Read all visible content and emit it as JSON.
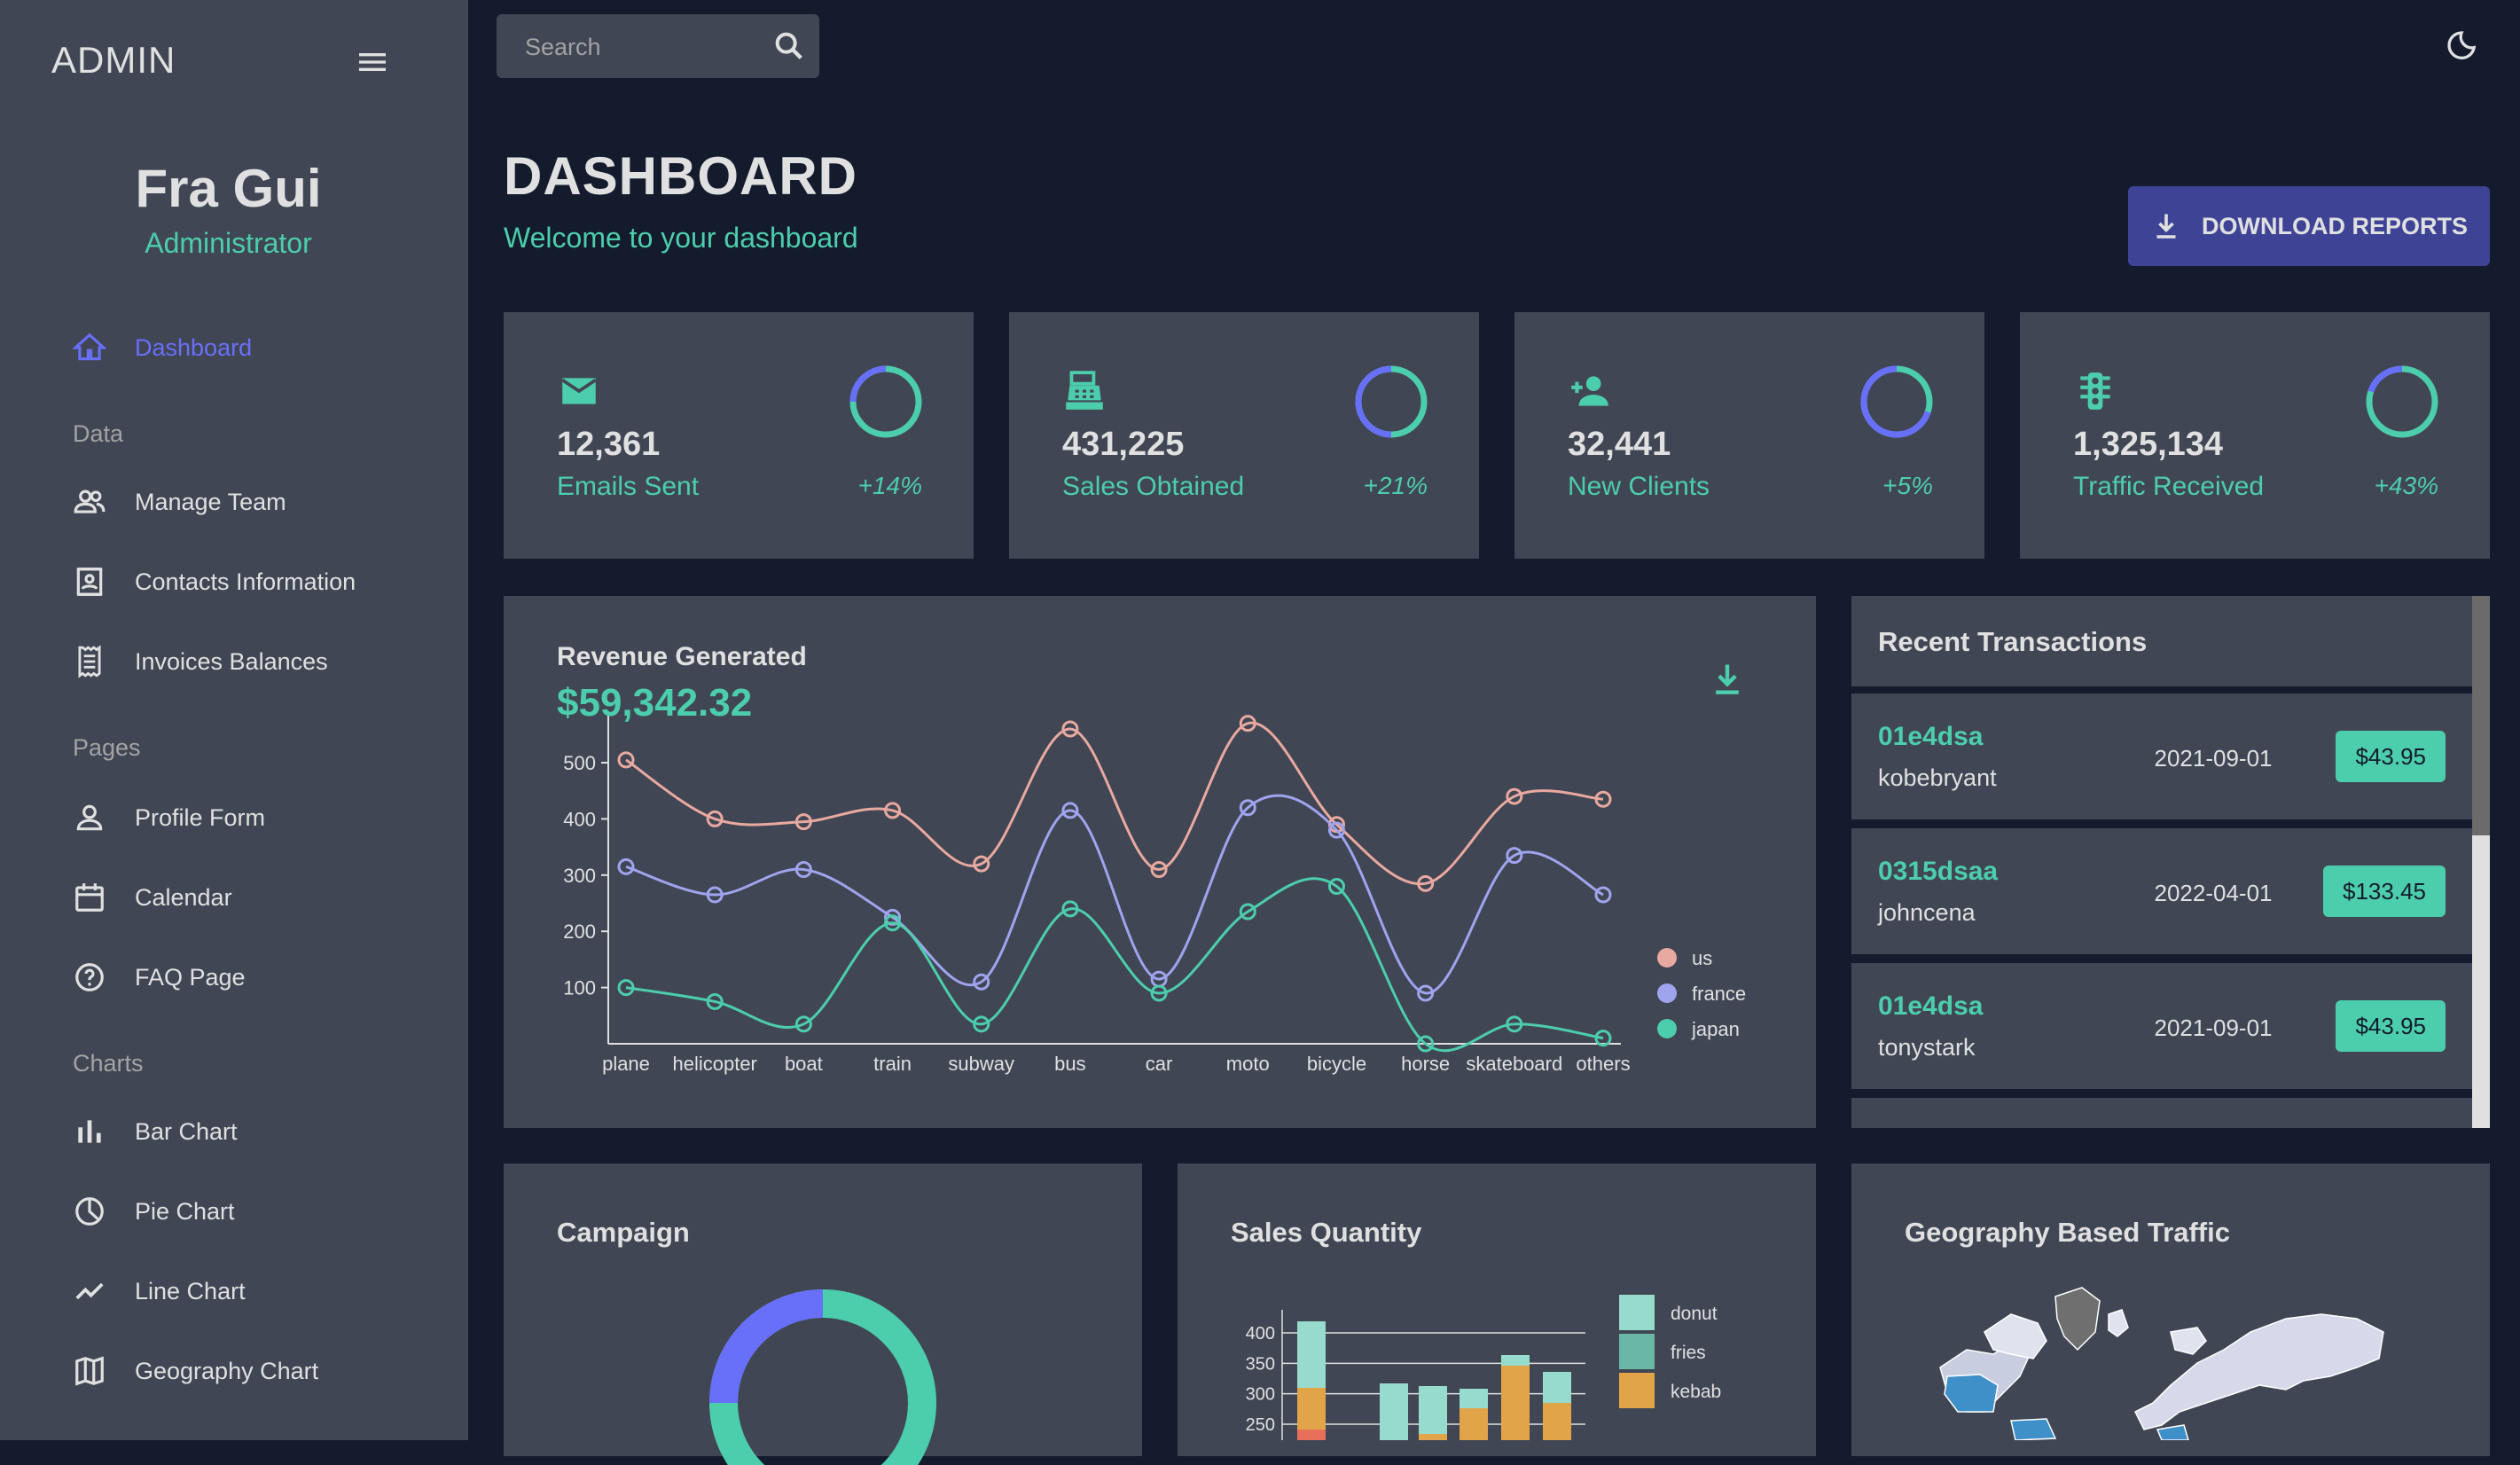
{
  "sidebar": {
    "brand": "ADMIN",
    "user_name": "Fra Gui",
    "user_role": "Administrator",
    "items": [
      {
        "label": "Dashboard",
        "icon": "home-icon",
        "active": true
      },
      {
        "label": "Manage Team",
        "icon": "people-icon"
      },
      {
        "label": "Contacts Information",
        "icon": "contacts-icon"
      },
      {
        "label": "Invoices Balances",
        "icon": "receipt-icon"
      },
      {
        "label": "Profile Form",
        "icon": "person-icon"
      },
      {
        "label": "Calendar",
        "icon": "calendar-icon"
      },
      {
        "label": "FAQ Page",
        "icon": "help-icon"
      },
      {
        "label": "Bar Chart",
        "icon": "bar-chart-icon"
      },
      {
        "label": "Pie Chart",
        "icon": "pie-chart-icon"
      },
      {
        "label": "Line Chart",
        "icon": "line-chart-icon"
      },
      {
        "label": "Geography Chart",
        "icon": "map-icon"
      }
    ],
    "sections": {
      "data": "Data",
      "pages": "Pages",
      "charts": "Charts"
    }
  },
  "topbar": {
    "search_placeholder": "Search"
  },
  "header": {
    "title": "DASHBOARD",
    "subtitle": "Welcome to your dashboard",
    "download_label": "DOWNLOAD REPORTS"
  },
  "stats": [
    {
      "value": "12,361",
      "label": "Emails Sent",
      "increase": "+14%",
      "progress": 0.75,
      "icon": "email-icon"
    },
    {
      "value": "431,225",
      "label": "Sales Obtained",
      "increase": "+21%",
      "progress": 0.5,
      "icon": "point-of-sale-icon"
    },
    {
      "value": "32,441",
      "label": "New Clients",
      "increase": "+5%",
      "progress": 0.3,
      "icon": "person-add-icon"
    },
    {
      "value": "1,325,134",
      "label": "Traffic Received",
      "increase": "+43%",
      "progress": 0.8,
      "icon": "traffic-icon"
    }
  ],
  "revenue": {
    "title": "Revenue Generated",
    "value": "$59,342.32"
  },
  "transactions": {
    "title": "Recent Transactions",
    "rows": [
      {
        "txId": "01e4dsa",
        "user": "kobebryant",
        "date": "2021-09-01",
        "cost": "$43.95"
      },
      {
        "txId": "0315dsaa",
        "user": "johncena",
        "date": "2022-04-01",
        "cost": "$133.45"
      },
      {
        "txId": "01e4dsa",
        "user": "tonystark",
        "date": "2021-09-01",
        "cost": "$43.95"
      }
    ]
  },
  "bottom": {
    "campaign_title": "Campaign",
    "sales_title": "Sales Quantity",
    "geo_title": "Geography Based Traffic"
  },
  "colors": {
    "bg": "#141b2d",
    "panel": "#414654",
    "accent": "#4cceac",
    "primary": "#6870fa",
    "button": "#3e4396"
  },
  "chart_data": [
    {
      "type": "line",
      "categories": [
        "plane",
        "helicopter",
        "boat",
        "train",
        "subway",
        "bus",
        "car",
        "moto",
        "bicycle",
        "horse",
        "skateboard",
        "others"
      ],
      "series": [
        {
          "name": "us",
          "color": "#e8a9a0",
          "values": [
            505,
            400,
            395,
            415,
            320,
            560,
            310,
            570,
            390,
            285,
            440,
            435
          ]
        },
        {
          "name": "france",
          "color": "#9fa4ee",
          "values": [
            315,
            265,
            310,
            225,
            110,
            415,
            115,
            420,
            380,
            90,
            335,
            265
          ]
        },
        {
          "name": "japan",
          "color": "#4cceac",
          "values": [
            100,
            75,
            35,
            215,
            35,
            240,
            90,
            235,
            280,
            0,
            35,
            10
          ]
        }
      ],
      "yticks": [
        100,
        200,
        300,
        400,
        500
      ],
      "ylim": [
        0,
        560
      ],
      "legend": "right"
    },
    {
      "type": "pie",
      "values": [
        0.75,
        0.25
      ]
    },
    {
      "type": "bar",
      "yticks": [
        250,
        300,
        350,
        400
      ],
      "series": [
        {
          "name": "donut",
          "color": "#96dbcb"
        },
        {
          "name": "fries",
          "color": "#6ab7a6"
        },
        {
          "name": "kebab",
          "color": "#e2a448"
        }
      ]
    }
  ]
}
